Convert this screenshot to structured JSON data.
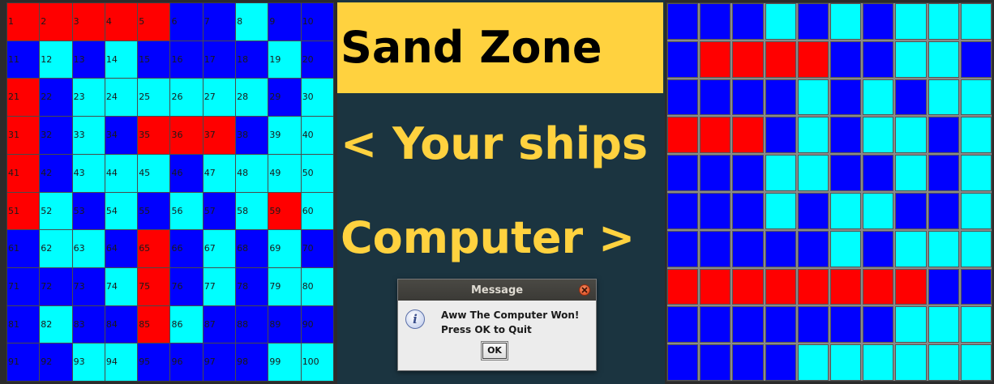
{
  "colors": {
    "red": "#ff0000",
    "blue": "#0000ff",
    "cyan": "#00ffff",
    "title_bg": "#ffd23f",
    "center_bg": "#1b3440",
    "text_yellow": "#ffd23f"
  },
  "title": "Sand Zone",
  "your_ships_label": "< Your ships",
  "computer_label": "Computer >",
  "player_grid": {
    "labels": [
      "1",
      "2",
      "3",
      "4",
      "5",
      "6",
      "7",
      "8",
      "9",
      "10",
      "11",
      "12",
      "13",
      "14",
      "15",
      "16",
      "17",
      "18",
      "19",
      "20",
      "21",
      "22",
      "23",
      "24",
      "25",
      "26",
      "27",
      "28",
      "29",
      "30",
      "31",
      "32",
      "33",
      "34",
      "35",
      "36",
      "37",
      "38",
      "39",
      "40",
      "41",
      "42",
      "43",
      "44",
      "45",
      "46",
      "47",
      "48",
      "49",
      "50",
      "51",
      "52",
      "53",
      "54",
      "55",
      "56",
      "57",
      "58",
      "59",
      "60",
      "61",
      "62",
      "63",
      "64",
      "65",
      "66",
      "67",
      "68",
      "69",
      "70",
      "71",
      "72",
      "73",
      "74",
      "75",
      "76",
      "77",
      "78",
      "79",
      "80",
      "81",
      "82",
      "83",
      "84",
      "85",
      "86",
      "87",
      "88",
      "89",
      "90",
      "91",
      "92",
      "93",
      "94",
      "95",
      "96",
      "97",
      "98",
      "99",
      "100"
    ],
    "colors": [
      "red",
      "red",
      "red",
      "red",
      "red",
      "blue",
      "blue",
      "cyan",
      "blue",
      "blue",
      "blue",
      "cyan",
      "blue",
      "cyan",
      "blue",
      "blue",
      "blue",
      "blue",
      "cyan",
      "blue",
      "red",
      "blue",
      "cyan",
      "cyan",
      "cyan",
      "cyan",
      "cyan",
      "cyan",
      "blue",
      "cyan",
      "red",
      "blue",
      "cyan",
      "blue",
      "red",
      "red",
      "red",
      "blue",
      "cyan",
      "cyan",
      "red",
      "blue",
      "cyan",
      "cyan",
      "cyan",
      "blue",
      "cyan",
      "cyan",
      "cyan",
      "cyan",
      "red",
      "cyan",
      "blue",
      "cyan",
      "blue",
      "cyan",
      "blue",
      "cyan",
      "red",
      "cyan",
      "blue",
      "cyan",
      "cyan",
      "blue",
      "red",
      "blue",
      "cyan",
      "blue",
      "cyan",
      "blue",
      "blue",
      "blue",
      "blue",
      "cyan",
      "red",
      "blue",
      "cyan",
      "blue",
      "cyan",
      "cyan",
      "blue",
      "cyan",
      "blue",
      "blue",
      "red",
      "cyan",
      "blue",
      "blue",
      "blue",
      "blue",
      "blue",
      "blue",
      "cyan",
      "cyan",
      "blue",
      "blue",
      "blue",
      "blue",
      "cyan",
      "cyan"
    ]
  },
  "computer_grid": {
    "colors": [
      "blue",
      "blue",
      "blue",
      "cyan",
      "blue",
      "cyan",
      "blue",
      "cyan",
      "cyan",
      "cyan",
      "blue",
      "red",
      "red",
      "red",
      "red",
      "blue",
      "blue",
      "cyan",
      "cyan",
      "blue",
      "blue",
      "blue",
      "blue",
      "blue",
      "cyan",
      "blue",
      "cyan",
      "blue",
      "cyan",
      "cyan",
      "red",
      "red",
      "red",
      "blue",
      "cyan",
      "blue",
      "cyan",
      "cyan",
      "blue",
      "cyan",
      "blue",
      "blue",
      "blue",
      "cyan",
      "cyan",
      "blue",
      "blue",
      "cyan",
      "blue",
      "cyan",
      "blue",
      "blue",
      "blue",
      "cyan",
      "blue",
      "cyan",
      "cyan",
      "blue",
      "blue",
      "cyan",
      "blue",
      "blue",
      "blue",
      "blue",
      "blue",
      "cyan",
      "blue",
      "cyan",
      "cyan",
      "cyan",
      "red",
      "red",
      "red",
      "red",
      "red",
      "red",
      "red",
      "red",
      "blue",
      "blue",
      "blue",
      "blue",
      "blue",
      "blue",
      "blue",
      "blue",
      "blue",
      "cyan",
      "cyan",
      "cyan",
      "blue",
      "blue",
      "blue",
      "blue",
      "cyan",
      "cyan",
      "cyan",
      "cyan",
      "cyan",
      "cyan"
    ]
  },
  "dialog": {
    "title": "Message",
    "line1": "Aww The Computer Won!",
    "line2": "Press OK to Quit",
    "ok_label": "OK",
    "icon": "info-icon",
    "close_icon": "close-icon"
  }
}
